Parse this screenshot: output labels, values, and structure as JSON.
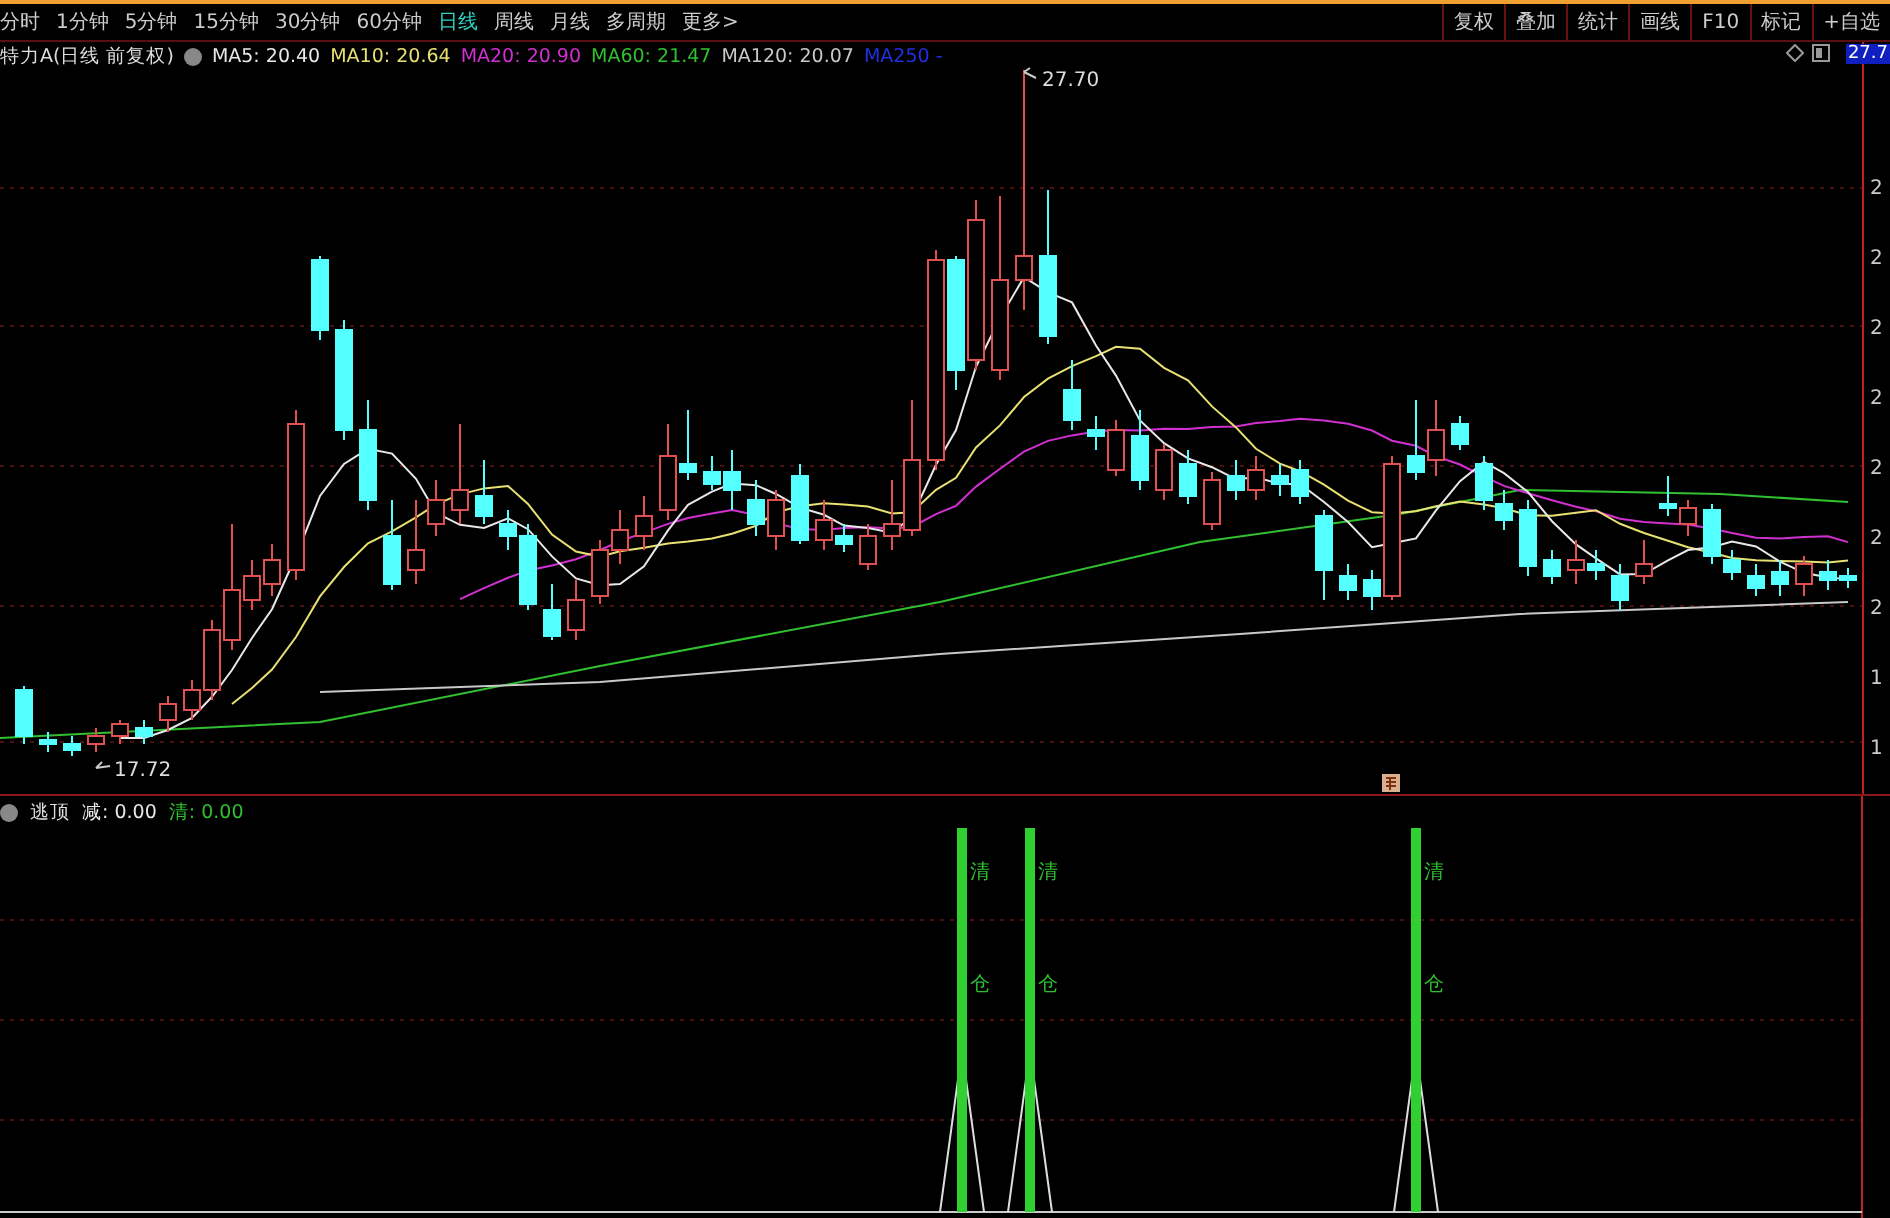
{
  "toolbar": {
    "periods": [
      {
        "label": "分时",
        "selected": false
      },
      {
        "label": "1分钟",
        "selected": false
      },
      {
        "label": "5分钟",
        "selected": false
      },
      {
        "label": "15分钟",
        "selected": false
      },
      {
        "label": "30分钟",
        "selected": false
      },
      {
        "label": "60分钟",
        "selected": false
      },
      {
        "label": "日线",
        "selected": true
      },
      {
        "label": "周线",
        "selected": false
      },
      {
        "label": "月线",
        "selected": false
      },
      {
        "label": "多周期",
        "selected": false
      },
      {
        "label": "更多>",
        "selected": false
      }
    ],
    "actions": [
      "复权",
      "叠加",
      "统计",
      "画线",
      "F10",
      "标记",
      "+自选"
    ]
  },
  "legend": {
    "title": "特力A(日线 前复权)",
    "averages": [
      {
        "text": "MA5: 20.40",
        "color": "#e8e8e8"
      },
      {
        "text": "MA10: 20.64",
        "color": "#e8e070"
      },
      {
        "text": "MA20: 20.90",
        "color": "#d030d0"
      },
      {
        "text": "MA60: 21.47",
        "color": "#30c030"
      },
      {
        "text": "MA120: 20.07",
        "color": "#c8c8c8"
      },
      {
        "text": "MA250 -",
        "color": "#2030e0"
      }
    ]
  },
  "price_tag": "27.7",
  "high_label": "27.70",
  "low_label": "17.72",
  "axis_labels": [
    "2",
    "2",
    "2",
    "2",
    "2",
    "2",
    "2",
    "1",
    "1"
  ],
  "indicator": {
    "name": "逃顶",
    "values": [
      {
        "text": "减: 0.00",
        "color": "#e8e8e8"
      },
      {
        "text": "清: 0.00",
        "color": "#30c030"
      }
    ],
    "signals": [
      {
        "labels": [
          "清",
          "仓"
        ]
      },
      {
        "labels": [
          "清",
          "仓"
        ]
      },
      {
        "labels": [
          "清",
          "仓"
        ]
      }
    ]
  }
}
